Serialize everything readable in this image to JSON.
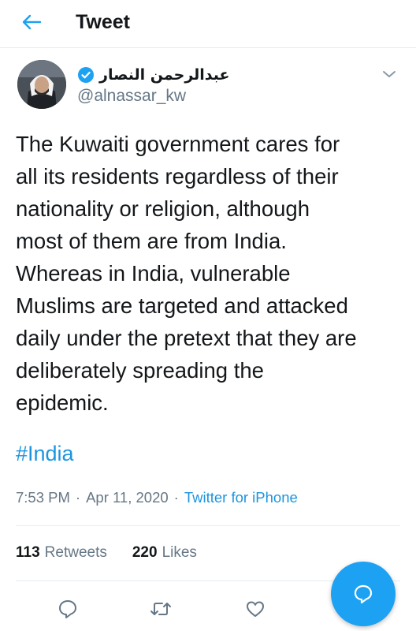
{
  "header": {
    "title": "Tweet",
    "back_icon": "arrow-left-icon"
  },
  "author": {
    "name": "عبدالرحمن النصار",
    "handle": "@alnassar_kw",
    "verified_icon": "verified-badge-icon",
    "menu_icon": "chevron-down-icon"
  },
  "tweet": {
    "text": "The Kuwaiti government cares for\nall its residents regardless of their\nnationality or religion, although\nmost of them are from India.\n Whereas in India, vulnerable\nMuslims are targeted and attacked\ndaily under the pretext that they are\ndeliberately spreading the\nepidemic.",
    "hashtag": "#India",
    "time": "7:53 PM",
    "sep1": "·",
    "date": "Apr 11, 2020",
    "sep2": "·",
    "source": "Twitter for iPhone"
  },
  "stats": {
    "retweets_count": "113",
    "retweets_label": "Retweets",
    "likes_count": "220",
    "likes_label": "Likes"
  },
  "actions": {
    "reply_icon": "reply-icon",
    "retweet_icon": "retweet-icon",
    "like_icon": "heart-icon",
    "compose_icon": "compose-reply-icon"
  },
  "colors": {
    "accent": "#1da1f2",
    "link": "#1b95e0",
    "text": "#14171a",
    "secondary": "#657786",
    "divider": "#e6ecf0"
  }
}
